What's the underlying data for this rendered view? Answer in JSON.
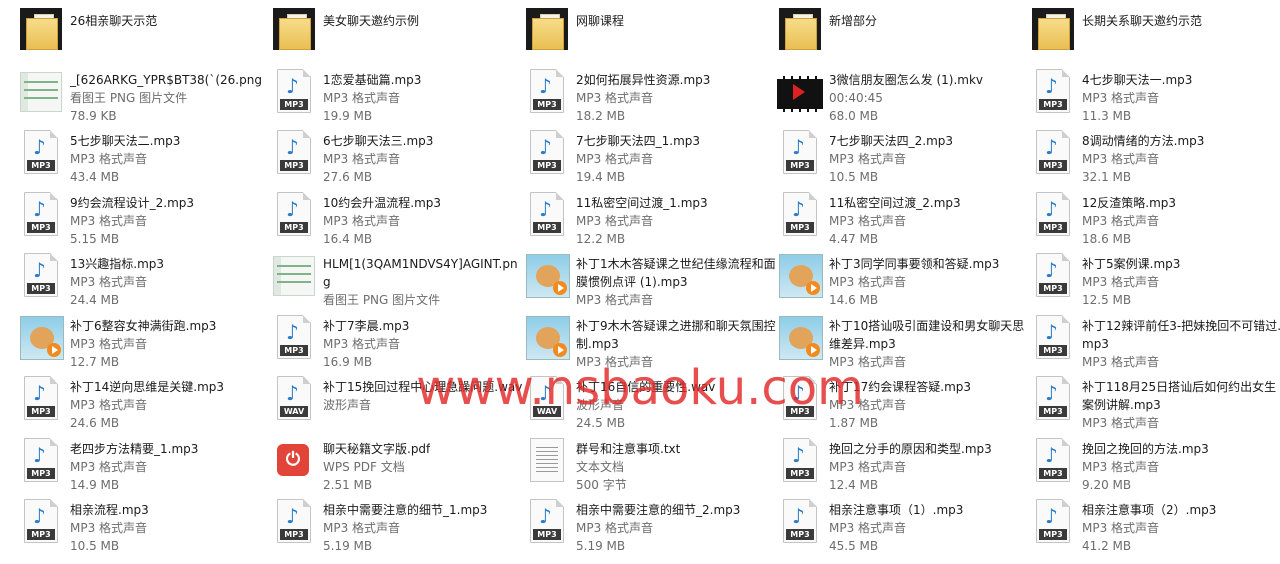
{
  "items": [
    {
      "type": "folder",
      "name": "26相亲聊天示范"
    },
    {
      "type": "folder",
      "name": "美女聊天邀约示例"
    },
    {
      "type": "folder",
      "name": "网聊课程"
    },
    {
      "type": "folder",
      "name": "新增部分"
    },
    {
      "type": "folder",
      "name": "长期关系聊天邀约示范"
    },
    {
      "type": "png",
      "name": "_[626ARKG_YPR$BT38(`(26.png",
      "kind": "看图王 PNG 图片文件",
      "size": "78.9 KB"
    },
    {
      "type": "mp3",
      "name": "1恋爱基础篇.mp3",
      "kind": "MP3 格式声音",
      "size": "19.9 MB"
    },
    {
      "type": "mp3",
      "name": "2如何拓展异性资源.mp3",
      "kind": "MP3 格式声音",
      "size": "18.2 MB"
    },
    {
      "type": "video",
      "name": "3微信朋友圈怎么发 (1).mkv",
      "kind": "00:40:45",
      "size": "68.0 MB"
    },
    {
      "type": "mp3",
      "name": "4七步聊天法一.mp3",
      "kind": "MP3 格式声音",
      "size": "11.3 MB"
    },
    {
      "type": "mp3",
      "name": "5七步聊天法二.mp3",
      "kind": "MP3 格式声音",
      "size": "43.4 MB"
    },
    {
      "type": "mp3",
      "name": "6七步聊天法三.mp3",
      "kind": "MP3 格式声音",
      "size": "27.6 MB"
    },
    {
      "type": "mp3",
      "name": "7七步聊天法四_1.mp3",
      "kind": "MP3 格式声音",
      "size": "19.4 MB"
    },
    {
      "type": "mp3",
      "name": "7七步聊天法四_2.mp3",
      "kind": "MP3 格式声音",
      "size": "10.5 MB"
    },
    {
      "type": "mp3",
      "name": "8调动情绪的方法.mp3",
      "kind": "MP3 格式声音",
      "size": "32.1 MB"
    },
    {
      "type": "mp3",
      "name": "9约会流程设计_2.mp3",
      "kind": "MP3 格式声音",
      "size": "5.15 MB"
    },
    {
      "type": "mp3",
      "name": "10约会升温流程.mp3",
      "kind": "MP3 格式声音",
      "size": "16.4 MB"
    },
    {
      "type": "mp3",
      "name": "11私密空间过渡_1.mp3",
      "kind": "MP3 格式声音",
      "size": "12.2 MB"
    },
    {
      "type": "mp3",
      "name": "11私密空间过渡_2.mp3",
      "kind": "MP3 格式声音",
      "size": "4.47 MB"
    },
    {
      "type": "mp3",
      "name": "12反渣策略.mp3",
      "kind": "MP3 格式声音",
      "size": "18.6 MB"
    },
    {
      "type": "mp3",
      "name": "13兴趣指标.mp3",
      "kind": "MP3 格式声音",
      "size": "24.4 MB"
    },
    {
      "type": "png",
      "name": "HLM[1(3QAM1NDVS4Y]AGINT.png",
      "kind": "看图王 PNG 图片文件",
      "size": ""
    },
    {
      "type": "toon",
      "name": "补丁1木木答疑课之世纪佳缘流程和面膜惯例点评 (1).mp3",
      "kind": "MP3 格式声音",
      "size": ""
    },
    {
      "type": "toon",
      "name": "补丁3同学同事要领和答疑.mp3",
      "kind": "MP3 格式声音",
      "size": "14.6 MB"
    },
    {
      "type": "mp3",
      "name": "补丁5案例课.mp3",
      "kind": "MP3 格式声音",
      "size": "12.5 MB"
    },
    {
      "type": "toon",
      "name": "补丁6整容女神满街跑.mp3",
      "kind": "MP3 格式声音",
      "size": "12.7 MB"
    },
    {
      "type": "mp3",
      "name": "补丁7李晨.mp3",
      "kind": "MP3 格式声音",
      "size": "16.9 MB"
    },
    {
      "type": "toon",
      "name": "补丁9木木答疑课之进挪和聊天氛围控制.mp3",
      "kind": "MP3 格式声音",
      "size": ""
    },
    {
      "type": "toon",
      "name": "补丁10搭讪吸引面建设和男女聊天思维差异.mp3",
      "kind": "MP3 格式声音",
      "size": ""
    },
    {
      "type": "mp3",
      "name": "补丁12辣评前任3-把妹挽回不可错过.mp3",
      "kind": "MP3 格式声音",
      "size": ""
    },
    {
      "type": "mp3",
      "name": "补丁14逆向思维是关键.mp3",
      "kind": "MP3 格式声音",
      "size": "24.6 MB"
    },
    {
      "type": "wav",
      "name": "补丁15挽回过程中心理急躁问题.wav",
      "kind": "波形声音",
      "size": ""
    },
    {
      "type": "wav",
      "name": "补丁16自信的重要性.wav",
      "kind": "波形声音",
      "size": "24.5 MB"
    },
    {
      "type": "mp3",
      "name": "补丁17约会课程答疑.mp3",
      "kind": "MP3 格式声音",
      "size": "1.87 MB"
    },
    {
      "type": "mp3",
      "name": "补丁118月25日搭讪后如何约出女生案例讲解.mp3",
      "kind": "MP3 格式声音",
      "size": ""
    },
    {
      "type": "mp3",
      "name": "老四步方法精要_1.mp3",
      "kind": "MP3 格式声音",
      "size": "14.9 MB"
    },
    {
      "type": "pdf",
      "name": "聊天秘籍文字版.pdf",
      "kind": "WPS PDF 文档",
      "size": "2.51 MB"
    },
    {
      "type": "txt",
      "name": "群号和注意事项.txt",
      "kind": "文本文档",
      "size": "500 字节"
    },
    {
      "type": "mp3",
      "name": "挽回之分手的原因和类型.mp3",
      "kind": "MP3 格式声音",
      "size": "12.4 MB"
    },
    {
      "type": "mp3",
      "name": "挽回之挽回的方法.mp3",
      "kind": "MP3 格式声音",
      "size": "9.20 MB"
    },
    {
      "type": "mp3",
      "name": "相亲流程.mp3",
      "kind": "MP3 格式声音",
      "size": "10.5 MB"
    },
    {
      "type": "mp3",
      "name": "相亲中需要注意的细节_1.mp3",
      "kind": "MP3 格式声音",
      "size": "5.19 MB"
    },
    {
      "type": "mp3",
      "name": "相亲中需要注意的细节_2.mp3",
      "kind": "MP3 格式声音",
      "size": "5.19 MB"
    },
    {
      "type": "mp3",
      "name": "相亲注意事项（1）.mp3",
      "kind": "MP3 格式声音",
      "size": "45.5 MB"
    },
    {
      "type": "mp3",
      "name": "相亲注意事项（2）.mp3",
      "kind": "MP3 格式声音",
      "size": "41.2 MB"
    }
  ],
  "icon_labels": {
    "mp3": "MP3",
    "wav": "WAV",
    "pdf": "⏻"
  },
  "watermark": "www.nsbaoku.com"
}
